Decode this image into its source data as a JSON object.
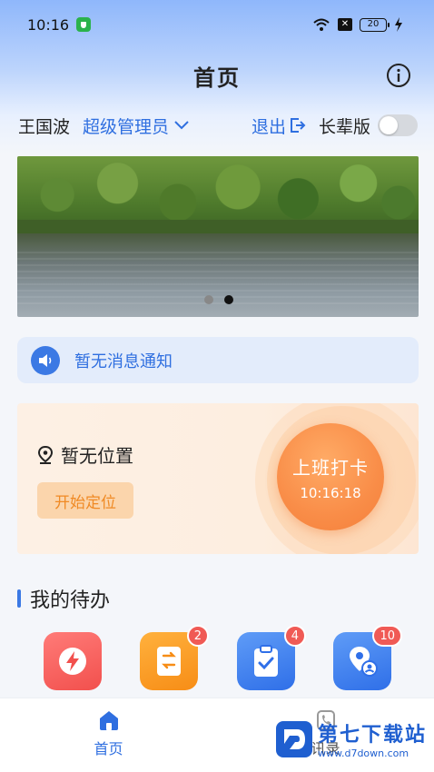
{
  "statusbar": {
    "time": "10:16",
    "battery": "20"
  },
  "header": {
    "title": "首页"
  },
  "user": {
    "name": "王国波",
    "role": "超级管理员",
    "logout": "退出",
    "elder_mode": "长辈版"
  },
  "notice": {
    "text": "暂无消息通知"
  },
  "clock": {
    "location": "暂无位置",
    "start_locate": "开始定位",
    "clock_in_label": "上班打卡",
    "clock_in_time": "10:16:18"
  },
  "todo": {
    "title": "我的待办",
    "items": [
      {
        "icon": "lightning-icon",
        "badge": ""
      },
      {
        "icon": "document-transfer-icon",
        "badge": "2"
      },
      {
        "icon": "clipboard-check-icon",
        "badge": "4"
      },
      {
        "icon": "location-person-icon",
        "badge": "10"
      }
    ]
  },
  "tabbar": {
    "home": "首页",
    "second": "讯录"
  },
  "watermark": {
    "name": "第七下载站",
    "url": "www.d7down.com"
  },
  "colors": {
    "accent": "#2f6fe0",
    "orange": "#f98d48",
    "badge_red": "#f05a55"
  }
}
